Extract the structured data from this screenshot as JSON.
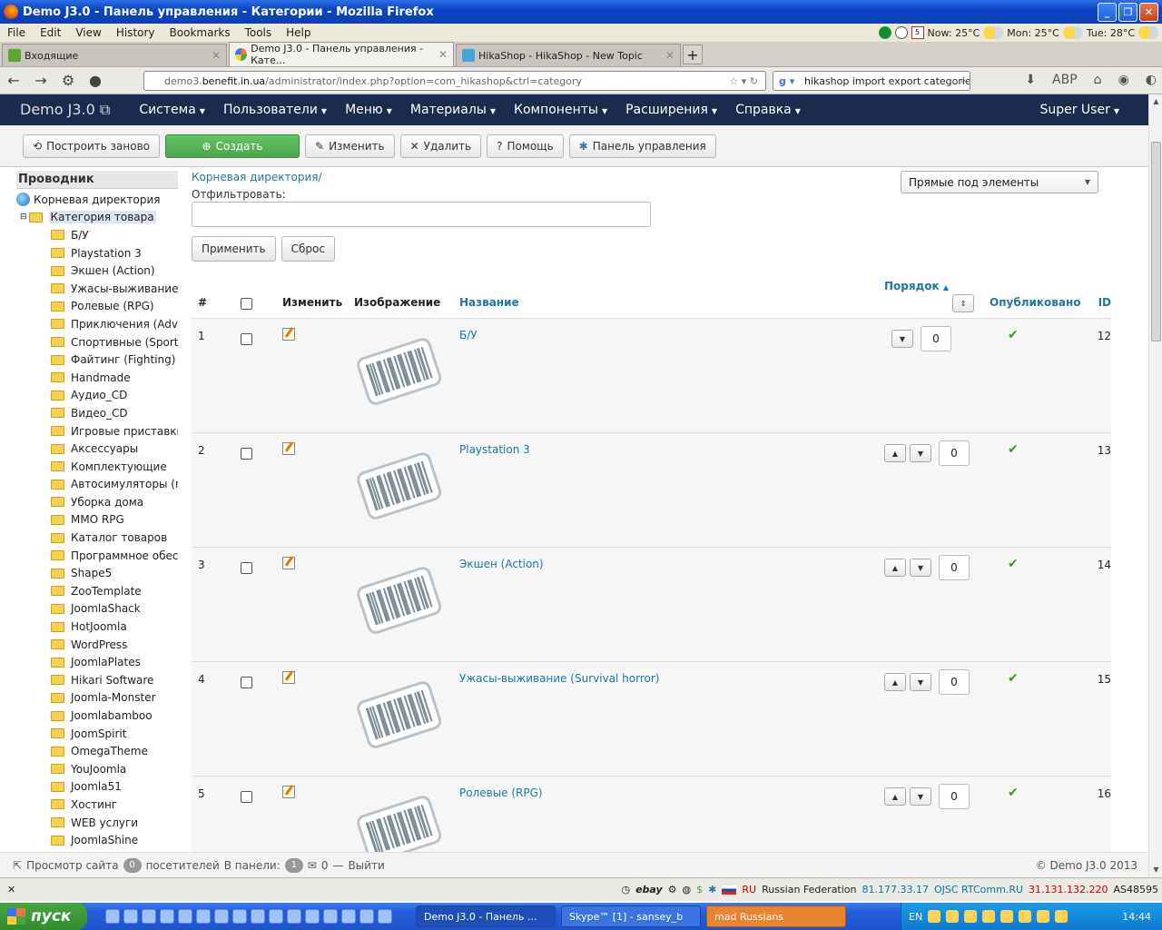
{
  "window": {
    "title": "Demo J3.0 - Панель управления - Категории - Mozilla Firefox"
  },
  "menu": [
    "File",
    "Edit",
    "View",
    "History",
    "Bookmarks",
    "Tools",
    "Help"
  ],
  "weather": {
    "date_badge": "5",
    "now": "Now: 25°C",
    "mon": "Mon: 25°C",
    "tue": "Tue: 28°C"
  },
  "tabs": [
    {
      "label": "Входящие",
      "active": false
    },
    {
      "label": "Demo J3.0 - Панель управления - Кате...",
      "active": true
    },
    {
      "label": "HikaShop - HikaShop - New Topic",
      "active": false
    }
  ],
  "url": {
    "prefix": "demo3.",
    "host": "benefit.in.ua",
    "path": "/administrator/index.php?option=com_hikashop&ctrl=category"
  },
  "search": {
    "value": "hikashop import export categories"
  },
  "joomla_nav": {
    "brand": "Demo J3.0",
    "items": [
      "Система",
      "Пользователи",
      "Меню",
      "Материалы",
      "Компоненты",
      "Расширения",
      "Справка"
    ],
    "user": "Super User"
  },
  "toolbar": {
    "rebuild": "Построить заново",
    "create": "Создать",
    "edit": "Изменить",
    "delete": "Удалить",
    "help": "Помощь",
    "dashboard": "Панель управления"
  },
  "sidebar": {
    "heading": "Проводник",
    "root": "Корневая директория",
    "selected": "Категория товара",
    "items": [
      "Б/У",
      "Playstation 3",
      "Экшен (Action)",
      "Ужасы-выживание (",
      "Ролевые (RPG)",
      "Приключения (Adve",
      "Спортивные (Sport)",
      "Файтинг (Fighting)",
      "Handmade",
      "Аудио_CD",
      "Видео_CD",
      "Игровые приставки і",
      "Аксессуары",
      "Комплектующие",
      "Автосимуляторы (гоі",
      "Уборка дома",
      "MMO RPG",
      "Каталог товаров",
      "Программное обеспе",
      "Shape5",
      "ZooTemplate",
      "JoomlaShack",
      "HotJoomla",
      "WordPress",
      "JoomlaPlates",
      "Hikari Software",
      "Joomla-Monster",
      "Joomlabamboo",
      "JoomSpirit",
      "OmegaTheme",
      "YouJoomla",
      "Joomla51",
      "Хостинг",
      "WEB услуги",
      "JoomlaShine"
    ]
  },
  "main": {
    "breadcrumb": "Корневая директория/",
    "filter_label": "Отфильтровать:",
    "filter_value": "",
    "apply": "Применить",
    "reset": "Сброс",
    "select": "Прямые под элементы"
  },
  "table": {
    "headers": {
      "num": "#",
      "edit": "Изменить",
      "image": "Изображение",
      "name": "Название",
      "order": "Порядок",
      "published": "Опубликовано",
      "id": "ID"
    },
    "rows": [
      {
        "num": "1",
        "name": "Б/У",
        "order": "0",
        "id": "12"
      },
      {
        "num": "2",
        "name": "Playstation 3",
        "order": "0",
        "id": "13"
      },
      {
        "num": "3",
        "name": "Экшен (Action)",
        "order": "0",
        "id": "14"
      },
      {
        "num": "4",
        "name": "Ужасы-выживание (Survival horror)",
        "order": "0",
        "id": "15"
      },
      {
        "num": "5",
        "name": "Ролевые (RPG)",
        "order": "0",
        "id": "16"
      }
    ]
  },
  "status": {
    "view_site": "Просмотр сайта",
    "visitors_count": "0",
    "visitors": "посетителей",
    "panel": "В панели:",
    "panel_count": "1",
    "messages": "0",
    "logout": "Выйти",
    "copyright": "© Demo J3.0 2013"
  },
  "addon": {
    "ebay": "ebay",
    "country_code": "RU",
    "country": "Russian Federation",
    "ip1": "81.177.33.17",
    "isp": "OJSC RTComm.RU",
    "ip2": "31.131.132.220",
    "asn": "AS48595"
  },
  "taskbar": {
    "start": "пуск",
    "tasks": [
      "Demo J3.0 - Панель ...",
      "Skype™ [1] - sansey_b",
      "mad Russians"
    ],
    "lang": "EN",
    "time": "14:44"
  }
}
